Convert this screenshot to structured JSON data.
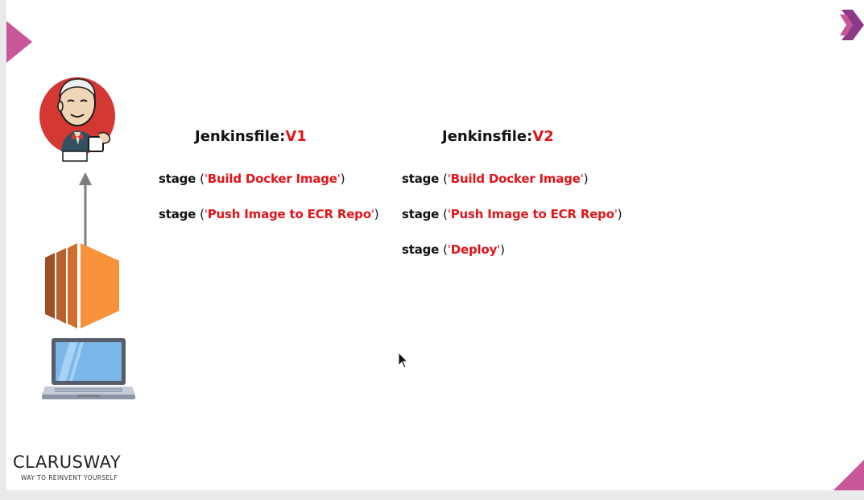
{
  "columns": [
    {
      "title_prefix": "Jenkinsfile:",
      "title_version": "V1",
      "stages": [
        {
          "keyword": "stage",
          "open": "(",
          "quote_open": "'",
          "name": "Build Docker Image",
          "quote_close": "'",
          "close": ")"
        },
        {
          "keyword": "stage",
          "open": "(",
          "quote_open": "'",
          "name": "Push Image to ECR Repo",
          "quote_close": "'",
          "close": ")"
        }
      ]
    },
    {
      "title_prefix": "Jenkinsfile:",
      "title_version": "V2",
      "stages": [
        {
          "keyword": "stage",
          "open": "(",
          "quote_open": "'",
          "name": "Build Docker Image",
          "quote_close": "'",
          "close": ")"
        },
        {
          "keyword": "stage",
          "open": "(",
          "quote_open": "'",
          "name": "Push Image to ECR Repo",
          "quote_close": "'",
          "close": ")"
        },
        {
          "keyword": "stage",
          "open": "(",
          "quote_open": "'",
          "name": "Deploy",
          "quote_close": "'",
          "close": ")"
        }
      ]
    }
  ],
  "brand": {
    "name": "CLARUSWAY",
    "tagline": "WAY TO REINVENT YOURSELF"
  },
  "icons": {
    "jenkins": "jenkins-butler-icon",
    "arrow": "up-arrow-icon",
    "ec2": "aws-ec2-icon",
    "laptop": "laptop-icon",
    "cursor": "mouse-pointer-icon",
    "next": "double-chevron-next-icon"
  },
  "colors": {
    "accent_red": "#e0161b",
    "aws_orange": "#f7913a",
    "decor_magenta": "#c2508f",
    "jenkins_red": "#d33833"
  }
}
